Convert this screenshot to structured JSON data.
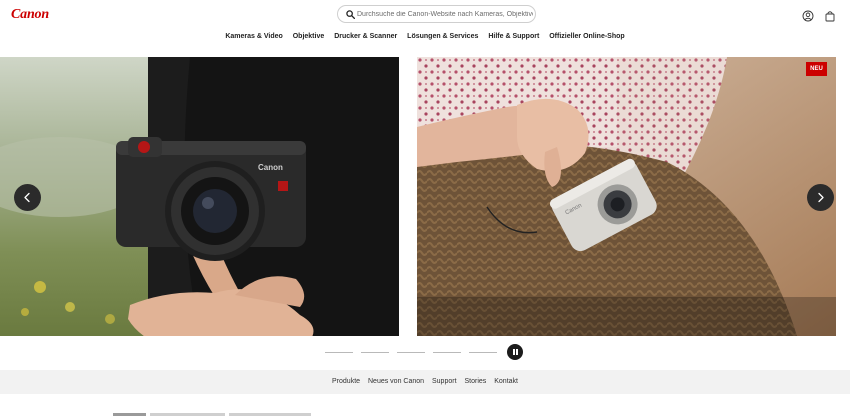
{
  "brand": {
    "logo_text": "Canon",
    "accent": "#cc0000"
  },
  "search": {
    "placeholder": "Durchsuche die Canon-Website nach Kameras, Objektive"
  },
  "header_icons": [
    "account-icon",
    "bag-icon"
  ],
  "nav": {
    "items": [
      {
        "label": "Kameras & Video"
      },
      {
        "label": "Objektive"
      },
      {
        "label": "Drucker & Scanner"
      },
      {
        "label": "Lösungen & Services"
      },
      {
        "label": "Hilfe & Support"
      },
      {
        "label": "Offizieller Online-Shop"
      }
    ]
  },
  "carousel": {
    "badge": "NEU",
    "slide_count": 5,
    "active_index": 0,
    "controls": [
      "chevron-left-icon",
      "chevron-right-icon",
      "pause-icon"
    ]
  },
  "subnav": {
    "items": [
      {
        "label": "Produkte"
      },
      {
        "label": "Neues von Canon"
      },
      {
        "label": "Support"
      },
      {
        "label": "Stories"
      },
      {
        "label": "Kontakt"
      }
    ]
  }
}
